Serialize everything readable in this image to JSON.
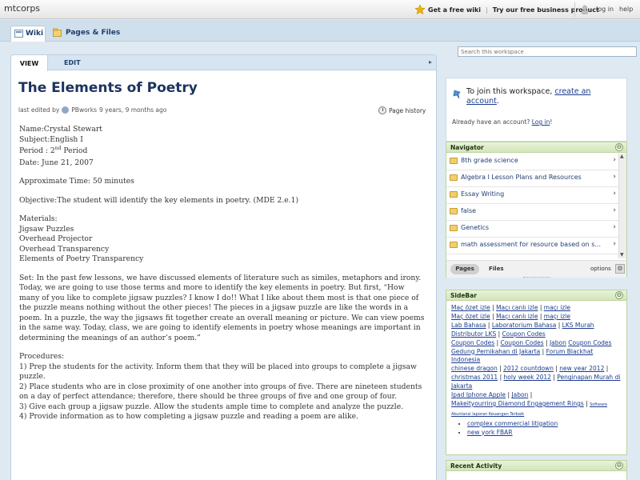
{
  "topbar": {
    "brand": "mtcorps",
    "get_wiki": "Get a free wiki",
    "try_business": "Try our free business product",
    "login": "log in",
    "help": "help"
  },
  "tabs": {
    "wiki": "Wiki",
    "pages_files": "Pages & Files"
  },
  "search": {
    "placeholder": "Search this workspace"
  },
  "page": {
    "view_tab": "VIEW",
    "edit_tab": "EDIT",
    "title": "The Elements of Poetry",
    "last_edited": "last edited by",
    "editor": "PBworks",
    "edited_ago": "9 years, 9 months ago",
    "page_history": "Page history"
  },
  "content": {
    "name": "Name:Crystal Stewart",
    "subject": "Subject:English I",
    "period_a": "Period : 2",
    "period_sup": "nd",
    "period_b": " Period",
    "date": "Date: June 21, 2007",
    "time": "Approximate Time: 50 minutes",
    "objective": "Objective:The student will identify the key elements in poetry. (MDE 2.e.1)",
    "materials": [
      "Materials:",
      "Jigsaw Puzzles",
      "Overhead Projector",
      "Overhead Transparency",
      "Elements of Poetry Transparency"
    ],
    "set": [
      "Set: In the past few lessons, we have discussed elements of literature such as similes, metaphors and irony.",
      "Today, we are going to use those terms and more to identify the key elements in poetry. But first, “How",
      "many of you like to complete jigsaw puzzles? I know I do!! What I like about them most is that one piece of",
      "the puzzle means nothing without the other pieces! The pieces in a jigsaw puzzle are like the words in a",
      "poem. In a puzzle, the way the jigsaws fit together create an overall meaning or picture. We can view poems",
      "in the same way. Today, class, we are going to identify elements in poetry whose meanings are important in",
      "determining the meanings of an author’s poem.”"
    ],
    "procedures": [
      "Procedures:",
      "1) Prep the students for the activity. Inform them that they will be placed into groups to complete a jigsaw",
      "puzzle.",
      "2) Place students who are in close proximity of one another into groups of five. There are nineteen students",
      "on a day of perfect attendance; therefore, there should be three groups of five and one group of four.",
      "3) Give each group a jigsaw puzzle. Allow the students ample time to complete and analyze the puzzle.",
      "4) Provide information as to how completing a jigsaw puzzle and reading a poem are alike."
    ]
  },
  "join": {
    "text": "To join this workspace,",
    "link": "create an account",
    "period": ".",
    "already": "Already have an account?",
    "login_link": "Log in",
    "bang": "!"
  },
  "navigator": {
    "title": "Navigator",
    "collapse": "⊖",
    "items": [
      "8th grade science",
      "Algebra I Lesson Plans and Resources",
      "Essay Writing",
      "false",
      "Genetics",
      "math assessment for resource based on s..."
    ],
    "pages_tab": "Pages",
    "files_tab": "Files",
    "options": "options"
  },
  "sidebar": {
    "title": "SideBar",
    "collapse": "⊖",
    "links": [
      "Maç özet izle",
      "Maçı canlı izle",
      "maçı izle",
      "Maç özet izle",
      "Maçı canlı izle",
      "maçı izle",
      "Lab Bahasa",
      "Laboratorium Bahasa",
      "LKS Murah",
      "Distributor LKS",
      "Coupon Codes",
      "Coupon Codes",
      "Coupon Codes",
      "Jabon",
      "Coupon Codes",
      "Gedung Pernikahan di Jakarta",
      "Forum Blackhat Indonesia",
      "chinese dragon",
      "2012 countdown",
      "new year 2012",
      "christmas 2011",
      "holy week 2012",
      "Penginapan Murah di Jakarta",
      "Ipad Iphone Apple",
      "Jabon",
      "Makeityourring Diamond Engagement Rings",
      "Software Akuntansi laporan Keuangan Terbaik"
    ],
    "bullets": [
      "complex commercial litigation",
      "new york FBAR"
    ]
  },
  "recent": {
    "title": "Recent Activity",
    "collapse": "⊖"
  },
  "colors": {
    "accent": "#1f3e70",
    "panel_green": "#d3e6ba",
    "link": "#1a3c8c"
  },
  "icons": [
    "star-icon",
    "user-icon",
    "wiki-icon",
    "pages-icon",
    "folder-icon",
    "gear-icon",
    "clock-icon",
    "pin-icon"
  ]
}
